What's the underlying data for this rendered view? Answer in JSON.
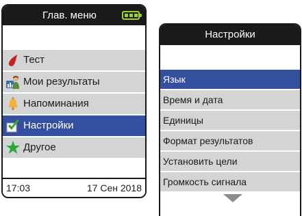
{
  "main_menu": {
    "title": "Глав. меню",
    "battery_icon": "battery-full-icon",
    "items": [
      {
        "label": "Тест",
        "icon": "blood-drop-icon",
        "selected": false
      },
      {
        "label": "Мои результаты",
        "icon": "person-chart-icon",
        "selected": false
      },
      {
        "label": "Напоминания",
        "icon": "bell-icon",
        "selected": false
      },
      {
        "label": "Настройки",
        "icon": "checkbox-checked-icon",
        "selected": true
      },
      {
        "label": "Другое",
        "icon": "star-icon",
        "selected": false
      }
    ],
    "footer": {
      "time": "17:03",
      "date": "17 Сен 2018"
    }
  },
  "settings_menu": {
    "title": "Настройки",
    "items": [
      {
        "label": "Язык",
        "selected": true
      },
      {
        "label": "Время и дата",
        "selected": false
      },
      {
        "label": "Единицы",
        "selected": false
      },
      {
        "label": "Формат результатов",
        "selected": false
      },
      {
        "label": "Установить цели",
        "selected": false
      },
      {
        "label": "Громкость сигнала",
        "selected": false
      }
    ],
    "scroll_icon": "scroll-down-arrow-icon"
  },
  "colors": {
    "header_bg": "#1a1a1a",
    "selected_bg": "#344f9e",
    "item_bg": "#d3d4d6",
    "battery": "#9ad32e"
  }
}
